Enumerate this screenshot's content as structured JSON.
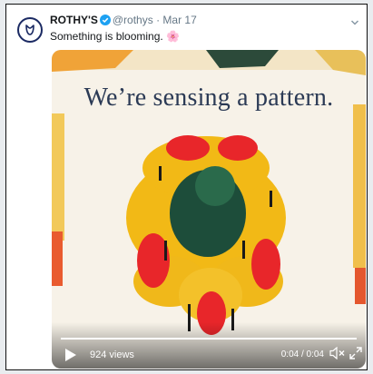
{
  "tweet": {
    "display_name": "ROTHY'S",
    "handle": "@rothys",
    "separator": "·",
    "date": "Mar 17",
    "text": "Something is blooming. 🌸"
  },
  "media": {
    "headline": "We’re sensing a pattern.",
    "views": "924 views",
    "time": "0:04 / 0:04",
    "progress": 1.0
  },
  "icons": {
    "avatar": "rothys-logo-icon",
    "verified": "verified-badge-icon",
    "more": "chevron-down-icon",
    "play": "play-icon",
    "mute": "speaker-muted-icon",
    "fullscreen": "expand-icon"
  },
  "colors": {
    "verified": "#1da1f2",
    "brand_navy": "#1b2a63",
    "flower_red": "#e8262a",
    "flower_yellow": "#f2b916",
    "flower_green": "#1d4d3a"
  }
}
